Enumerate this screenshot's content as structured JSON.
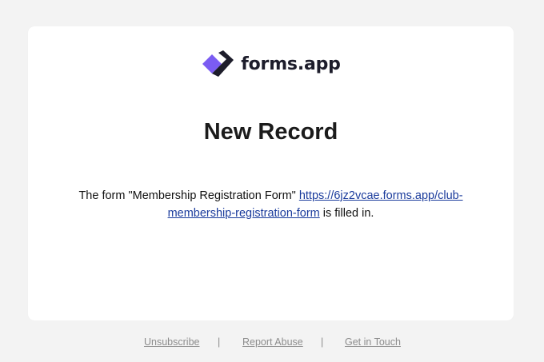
{
  "brand": {
    "name": "forms.app",
    "logo_icon": "forms-app-logo-icon",
    "accent_color": "#7b5cf2",
    "dark_color": "#1d1d2b"
  },
  "email": {
    "title": "New Record",
    "message_prefix": "The form \"Membership Registration Form\" ",
    "form_link": "https://6jz2vcae.forms.app/club-membership-registration-form",
    "message_suffix": " is filled in."
  },
  "footer": {
    "unsubscribe": "Unsubscribe",
    "separator": "|",
    "report_abuse": "Report Abuse",
    "get_in_touch": "Get in Touch"
  }
}
